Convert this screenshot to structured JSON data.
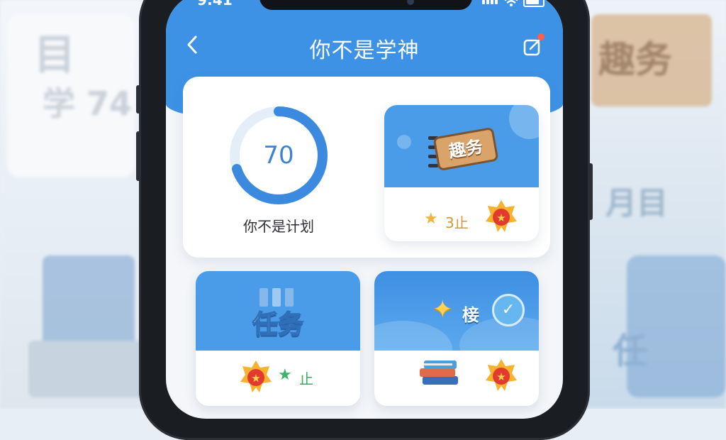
{
  "status_bar": {
    "time": "9:41"
  },
  "header": {
    "title": "你不是学神",
    "back_icon": "chevron-left-icon",
    "edit_icon": "edit-square-icon"
  },
  "progress": {
    "value": "70",
    "percent": 70,
    "label": "你不是计划"
  },
  "tiles": {
    "top_right": {
      "sticker_text": "趣务",
      "count": "3止"
    },
    "bottom_left": {
      "title": "任务",
      "count": "止"
    },
    "bottom_right": {
      "title": "椄"
    }
  },
  "background": {
    "left_text_1": "目",
    "left_text_2": "学 74",
    "right_plate": "趣务",
    "right_text_1": "月目",
    "right_text_2": "任"
  },
  "colors": {
    "accent": "#3d92e6",
    "ring": "#3b84d3",
    "gold": "#f2b23a",
    "green": "#3fb36c"
  }
}
